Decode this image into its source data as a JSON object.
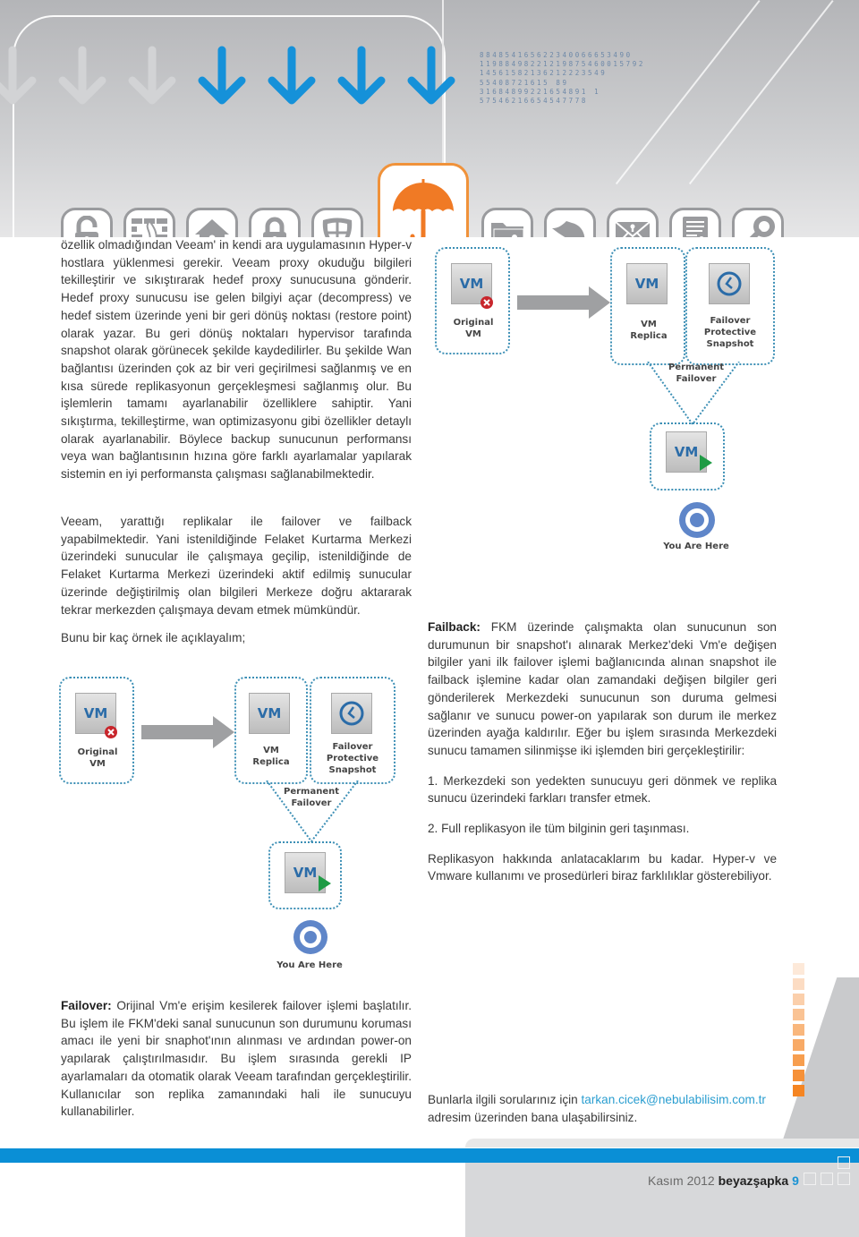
{
  "header": {
    "number_lines": [
      "884854165622340066653490",
      "11988498221219875460015792",
      "14561582136212223549",
      "55408721615 89",
      "31684899221654891 1",
      "57546216654547778"
    ],
    "icons": [
      "padlock-open-icon",
      "firewall-icon",
      "home-lock-icon",
      "padlock-closed-icon",
      "shield-icon",
      "umbrella-icon",
      "folder-lock-icon",
      "helmet-icon",
      "envelope-lock-icon",
      "document-lock-icon",
      "key-icon"
    ],
    "colors": {
      "arrow_active": "#1591d9",
      "arrow_faded": "#d2d3d5",
      "highlight": "#f07a25"
    }
  },
  "left_column": {
    "para1": "özellik olmadığından Veeam' in kendi ara uygulamasının Hyper-v hostlara yüklenmesi gerekir. Veeam proxy okuduğu bilgileri tekilleştirir ve sıkıştırarak hedef proxy sunucusuna gönderir. Hedef proxy sunucusu ise gelen bilgiyi açar (decompress) ve hedef sistem üzerinde yeni bir geri dönüş noktası (restore point) olarak yazar. Bu geri dönüş noktaları hypervisor tarafında snapshot olarak görünecek şekilde kaydedilirler. Bu şekilde Wan bağlantısı üzerinden çok az bir veri geçirilmesi sağlanmış ve en kısa sürede replikasyonun gerçekleşmesi sağlanmış olur. Bu işlemlerin tamamı ayarlanabilir özelliklere sahiptir. Yani sıkıştırma, tekilleştirme, wan optimizasyonu gibi özellikler detaylı olarak ayarlanabilir. Böylece backup sunucunun performansı veya wan bağlantısının hızına göre farklı ayarlamalar yapılarak sistemin en iyi performansta çalışması sağlanabilmektedir.",
    "para2": "Veeam, yarattığı replikalar ile failover ve failback yapabilmektedir. Yani istenildiğinde Felaket Kurtarma Merkezi üzerindeki sunucular ile çalışmaya geçilip, istenildiğinde de Felaket Kurtarma Merkezi üzerindeki aktif edilmiş sunucular üzerinde değiştirilmiş olan bilgileri Merkeze doğru aktararak tekrar merkezden çalışmaya devam etmek mümkündür.",
    "para3": "Bunu bir kaç örnek ile açıklayalım;",
    "failover_label": "Failover:",
    "failover_text": " Orijinal Vm'e erişim kesilerek failover işlemi başlatılır. Bu işlem ile FKM'deki sanal sunucunun son durumunu koruması amacı ile yeni bir snaphot'ının alınması ve ardından power-on yapılarak çalıştırılmasıdır. Bu işlem sırasında gerekli IP ayarlamaları da otomatik olarak Veeam tarafından gerçekleştirilir. Kullanıcılar son replika zamanındaki hali ile sunucuyu kullanabilirler."
  },
  "diagram": {
    "vm_text": "VM",
    "original_vm": "Original\nVM",
    "vm_replica": "VM\nReplica",
    "snapshot": "Failover\nProtective\nSnapshot",
    "permanent_failover": "Permanent\nFailover",
    "you_are_here": "You Are Here"
  },
  "right_column": {
    "failback_label": "Failback:",
    "failback_text": " FKM üzerinde çalışmakta olan sunucunun son durumunun bir snapshot'ı alınarak Merkez'deki Vm'e değişen bilgiler yani ilk failover işlemi bağlanıcında alınan snapshot ile failback işlemine kadar olan zamandaki değişen bilgiler geri gönderilerek Merkezdeki sunucunun son duruma gelmesi sağlanır ve sunucu power-on yapılarak son durum ile merkez üzerinden ayağa kaldırılır. Eğer bu işlem sırasında Merkezdeki sunucu tamamen silinmişse iki işlemden biri gerçekleştirilir:",
    "item1": "1. Merkezdeki son yedekten sunucuyu geri dönmek ve replika sunucu üzerindeki farkları transfer etmek.",
    "item2": "2. Full replikasyon ile tüm bilginin geri taşınması.",
    "closing": "Replikasyon hakkında anlatacaklarım bu kadar. Hyper-v ve Vmware kullanımı ve prosedürleri biraz farklılıklar gösterebiliyor.",
    "contact_prefix": "Bunlarla ilgili sorularınız için ",
    "contact_email": "tarkan.cicek@nebulabilisim.com.tr",
    "contact_suffix": "adresim üzerinden bana ulaşabilirsiniz."
  },
  "footer": {
    "date": "Kasım 2012",
    "brand": "beyazşapka",
    "page": "9",
    "accent": "#0a8fd6"
  }
}
